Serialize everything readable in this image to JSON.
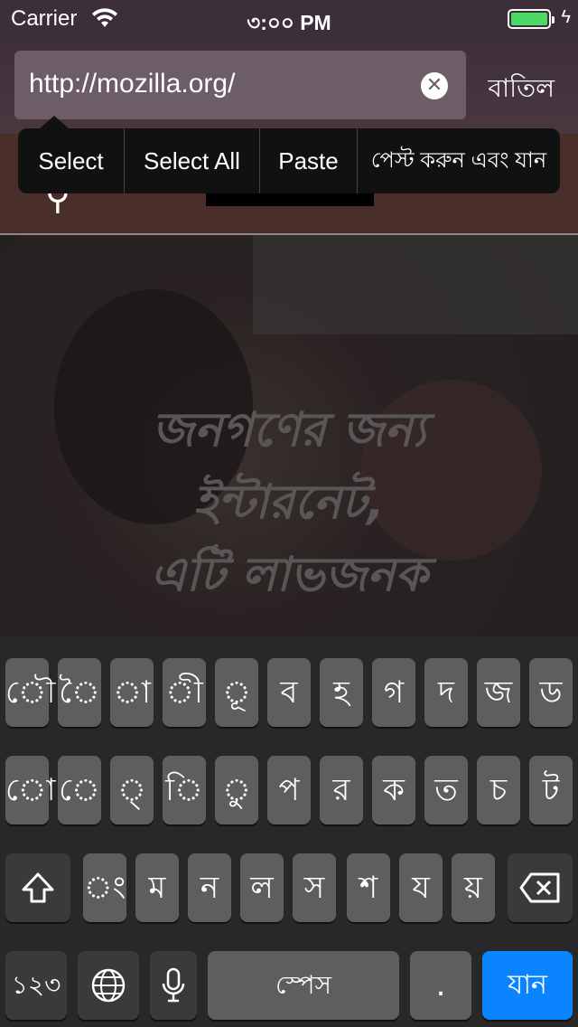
{
  "status_bar": {
    "carrier": "Carrier",
    "time": "৩:০০ PM"
  },
  "url_bar": {
    "url": "http://mozilla.org/",
    "cancel_label": "বাতিল"
  },
  "edit_menu": {
    "items": [
      "Select",
      "Select All",
      "Paste",
      "পেস্ট করুন এবং যান"
    ]
  },
  "page": {
    "hero_lines": [
      "জনগণের জন্য",
      "ইন্টারনেট,",
      "এটি লাভজনক"
    ]
  },
  "keyboard": {
    "row1": [
      "ৌ",
      "ৈ",
      "া",
      "ী",
      "ূ",
      "ব",
      "হ",
      "গ",
      "দ",
      "জ",
      "ড"
    ],
    "row2": [
      "ো",
      "ে",
      "্",
      "ি",
      "ু",
      "প",
      "র",
      "ক",
      "ত",
      "চ",
      "ট"
    ],
    "row3": [
      "ং",
      "ম",
      "ন",
      "ল",
      "স",
      "শ",
      "য",
      "য়"
    ],
    "numbers_label": "১২৩",
    "space_label": "স্পেস",
    "period_label": ".",
    "go_label": "যান"
  },
  "colors": {
    "accent": "#0a84ff",
    "battery": "#4cd964"
  }
}
